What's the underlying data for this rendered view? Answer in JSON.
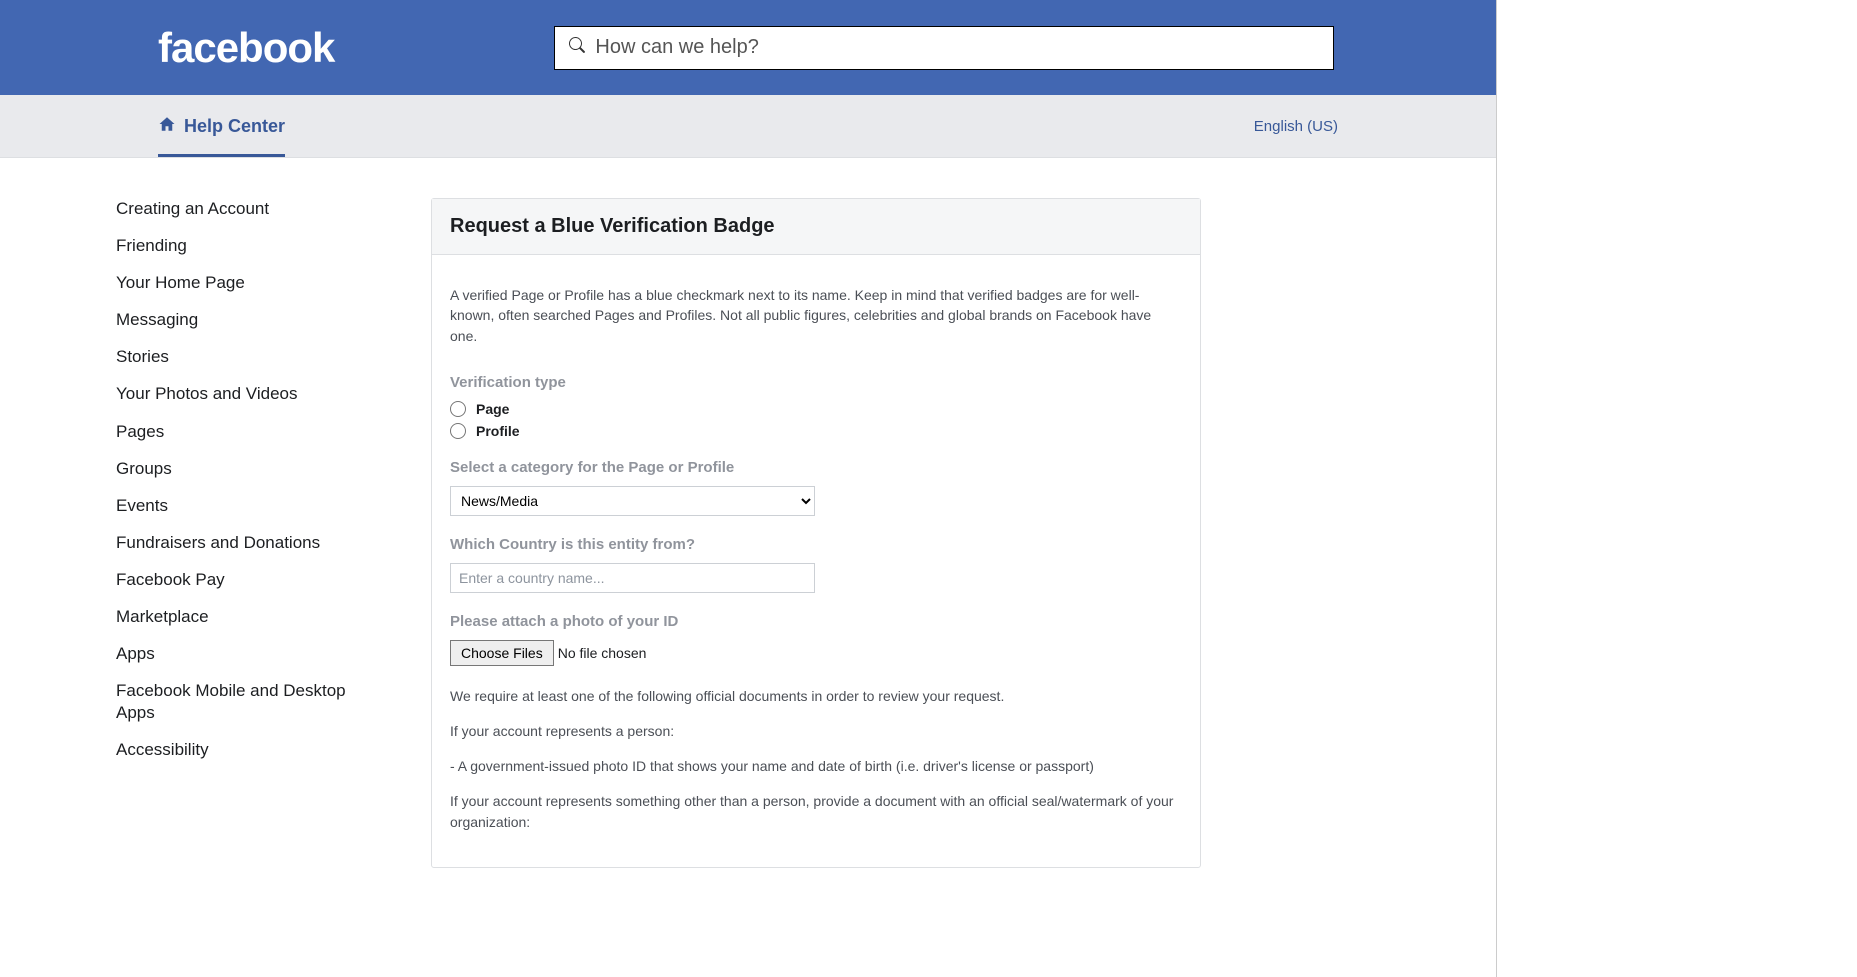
{
  "header": {
    "logo_text": "facebook",
    "search_placeholder": "How can we help?"
  },
  "nav": {
    "help_center": "Help Center",
    "language": "English (US)"
  },
  "sidebar": {
    "items": [
      "Creating an Account",
      "Friending",
      "Your Home Page",
      "Messaging",
      "Stories",
      "Your Photos and Videos",
      "Pages",
      "Groups",
      "Events",
      "Fundraisers and Donations",
      "Facebook Pay",
      "Marketplace",
      "Apps",
      "Facebook Mobile and Desktop Apps",
      "Accessibility"
    ]
  },
  "main": {
    "title": "Request a Blue Verification Badge",
    "intro": "A verified Page or Profile has a blue checkmark next to its name. Keep in mind that verified badges are for well-known, often searched Pages and Profiles. Not all public figures, celebrities and global brands on Facebook have one.",
    "verification_type_label": "Verification type",
    "radio_page": "Page",
    "radio_profile": "Profile",
    "category_label": "Select a category for the Page or Profile",
    "category_value": "News/Media",
    "country_label": "Which Country is this entity from?",
    "country_placeholder": "Enter a country name...",
    "photo_id_label": "Please attach a photo of your ID",
    "choose_files_btn": "Choose Files",
    "no_file_chosen": "No file chosen",
    "require_text": "We require at least one of the following official documents in order to review your request.",
    "if_person_label": "If your account represents a person:",
    "person_doc": "- A government-issued photo ID that shows your name and date of birth (i.e. driver's license or passport)",
    "if_other_label": "If your account represents something other than a person, provide a document with an official seal/watermark of your organization:"
  }
}
